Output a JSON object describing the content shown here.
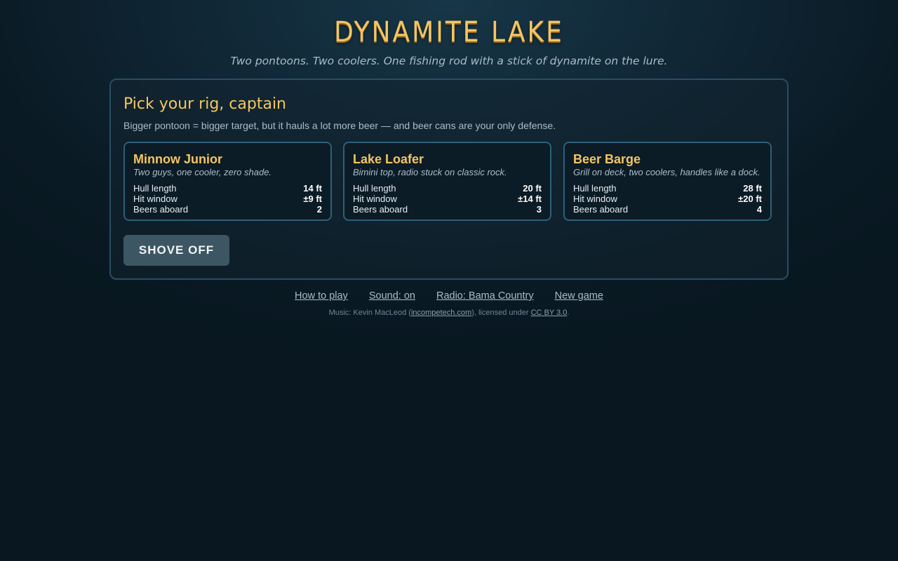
{
  "game": {
    "title": "DYNAMITE LAKE",
    "subtitle": "Two pontoons. Two coolers. One fishing rod with a stick of dynamite on the lure."
  },
  "panel": {
    "heading": "Pick your rig, captain",
    "description": "Bigger pontoon = bigger target, but it hauls a lot more beer — and beer cans are your only defense."
  },
  "rigs": [
    {
      "name": "Minnow Junior",
      "tagline": "Two guys, one cooler, zero shade.",
      "stats": [
        {
          "label": "Hull length",
          "value": "14 ft"
        },
        {
          "label": "Hit window",
          "value": "±9 ft"
        },
        {
          "label": "Beers aboard",
          "value": "2"
        }
      ]
    },
    {
      "name": "Lake Loafer",
      "tagline": "Bimini top, radio stuck on classic rock.",
      "stats": [
        {
          "label": "Hull length",
          "value": "20 ft"
        },
        {
          "label": "Hit window",
          "value": "±14 ft"
        },
        {
          "label": "Beers aboard",
          "value": "3"
        }
      ]
    },
    {
      "name": "Beer Barge",
      "tagline": "Grill on deck, two coolers, handles like a dock.",
      "stats": [
        {
          "label": "Hull length",
          "value": "28 ft"
        },
        {
          "label": "Hit window",
          "value": "±20 ft"
        },
        {
          "label": "Beers aboard",
          "value": "4"
        }
      ]
    }
  ],
  "actions": {
    "start_label": "SHOVE OFF"
  },
  "footer": {
    "links": [
      "How to play",
      "Sound: on",
      "Radio: Bama Country",
      "New game"
    ],
    "credit_prefix": "Music: Kevin MacLeod (",
    "credit_link": "incompetech.com",
    "credit_middle": "), licensed under ",
    "license_link": "CC BY 3.0",
    "credit_suffix": "."
  },
  "colors": {
    "accent": "#f4c563",
    "card_border": "#2f5f7a",
    "button_bg": "#3d5663"
  }
}
